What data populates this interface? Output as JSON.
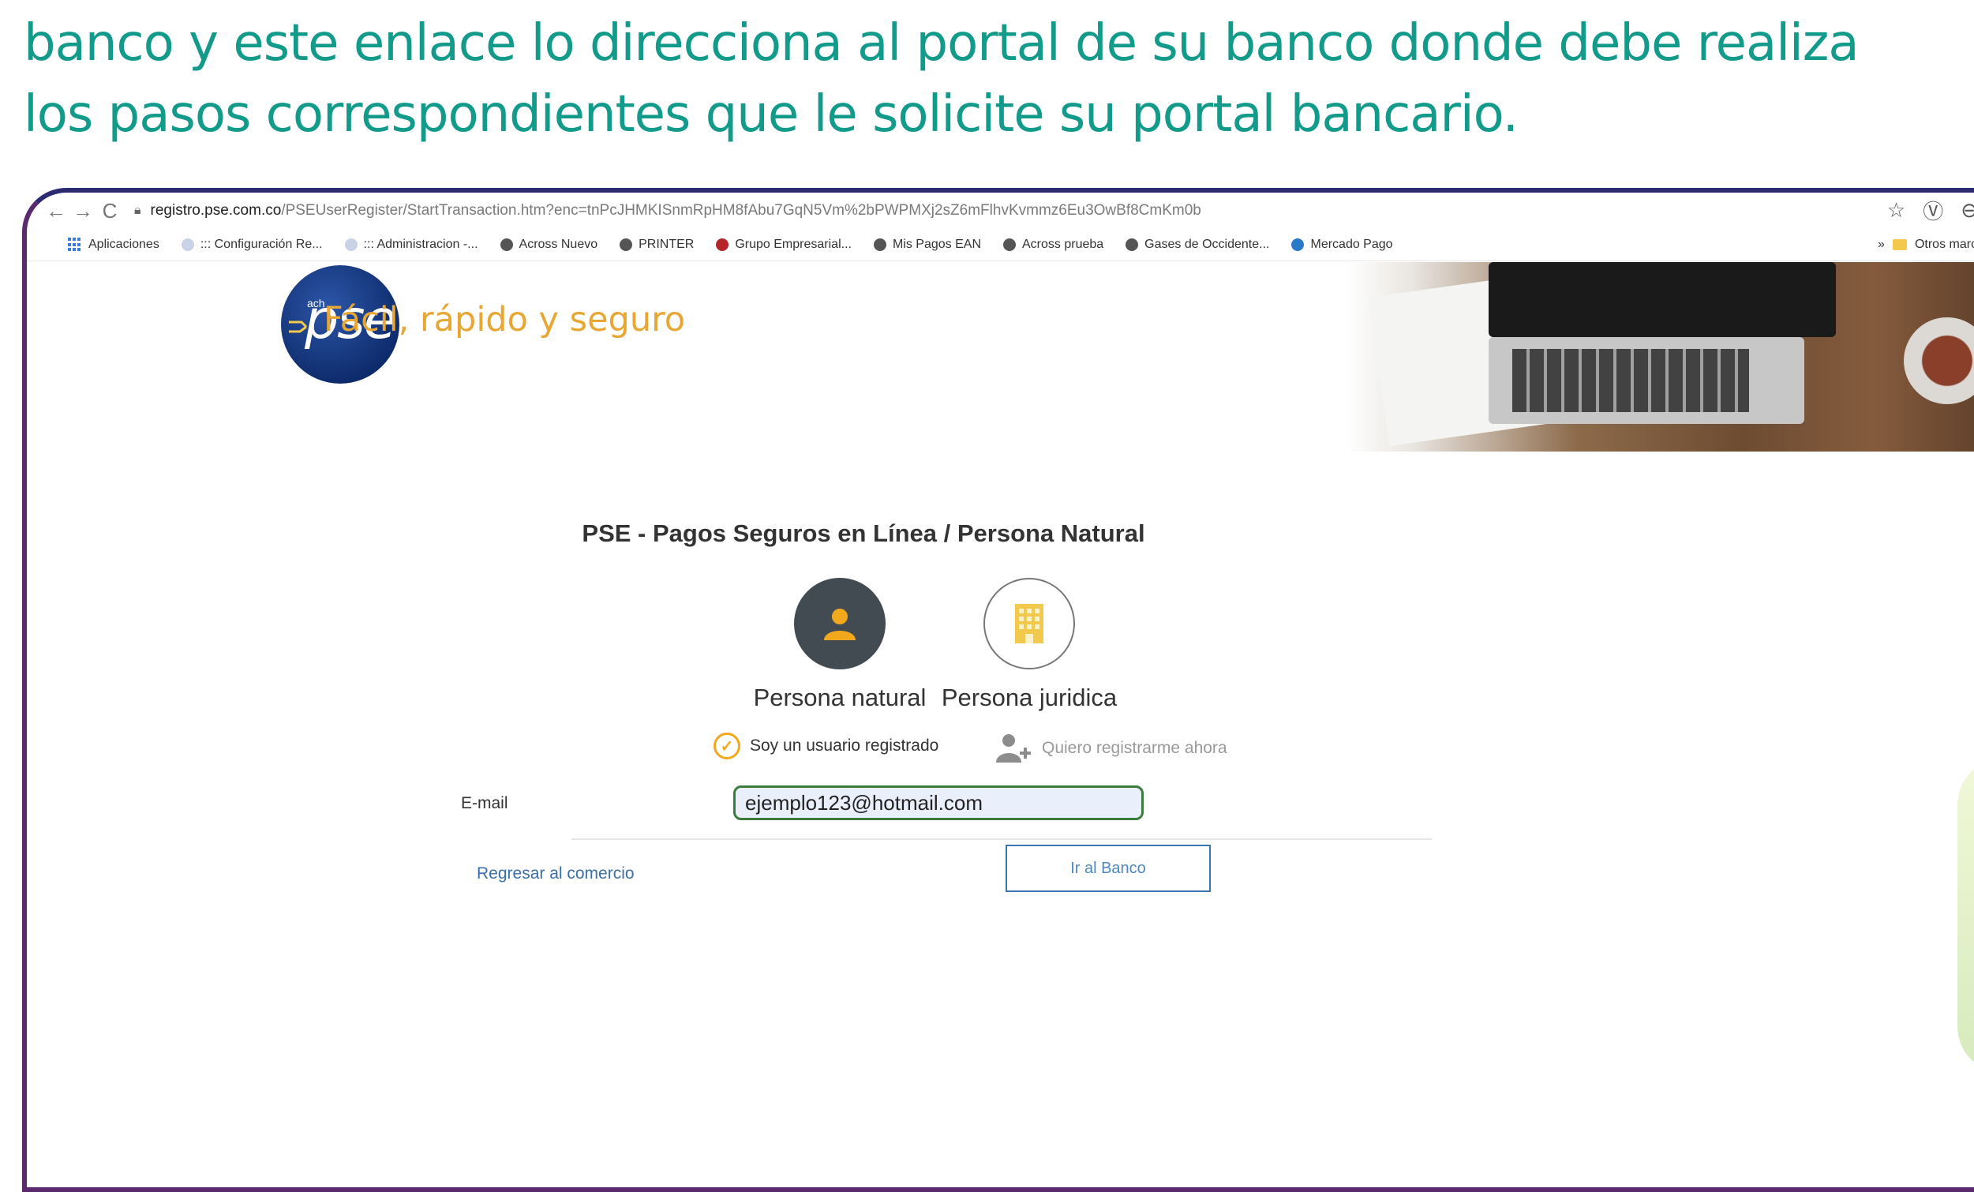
{
  "slide": {
    "line1": "banco y este enlace lo direcciona al portal de su banco donde debe realiza",
    "line2": "los pasos correspondientes que le solicite su portal bancario."
  },
  "browser": {
    "url_host": "registro.pse.com.co",
    "url_path": "/PSEUserRegister/StartTransaction.htm?enc=tnPcJHMKISnmRpHM8fAbu7GqN5Vm%2bPWPMXj2sZ6mFlhvKvmmz6Eu3OwBf8CmKm0b",
    "back_icon": "←",
    "forward_icon": "→",
    "reload_icon": "C",
    "star_icon": "☆",
    "extension_icon": "Ⓥ",
    "profile_icon": "⊖",
    "menu_icon": "⋮",
    "bookmarks": [
      "Aplicaciones",
      "::: Configuración Re...",
      "::: Administracion -...",
      "Across Nuevo",
      "PRINTER",
      "Grupo Empresarial...",
      "Mis Pagos EAN",
      "Across prueba",
      "Gases de Occidente...",
      "Mercado Pago"
    ],
    "more_bookmarks": "»",
    "other_bookmarks": "Otros marcadores"
  },
  "page": {
    "logo_text": "pse",
    "logo_sub": "ach",
    "tagline": "Fácil, rápido y seguro",
    "help": "?",
    "title": "PSE - Pagos Seguros en Línea / Persona Natural",
    "person_natural": "Persona natural",
    "person_juridica": "Persona juridica",
    "registered_user": "Soy un usuario registrado",
    "register_now": "Quiero registrarme ahora",
    "email_label": "E-mail",
    "email_value": "ejemplo123@hotmail.com",
    "back_link": "Regresar al comercio",
    "bank_button": "Ir al Banco"
  },
  "colors": {
    "slide_text": "#129a8a",
    "accent_orange": "#f2a81d",
    "logo_blue": "#1b3f8a",
    "link_blue": "#3a6ea8"
  }
}
